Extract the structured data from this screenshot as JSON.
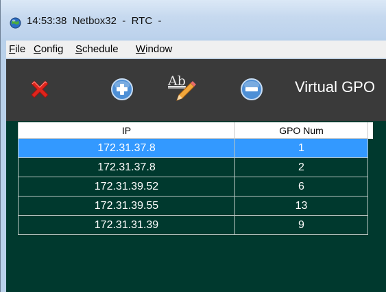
{
  "window": {
    "title": "14:53:38  Netbox32  -  RTC  -"
  },
  "menu": [
    {
      "mnemonic": "F",
      "rest": "ile"
    },
    {
      "mnemonic": "C",
      "rest": "onfig"
    },
    {
      "mnemonic": "S",
      "rest": "chedule"
    },
    {
      "mnemonic": "W",
      "rest": "indow"
    }
  ],
  "toolbar": {
    "title": "Virtual GPO",
    "icons": [
      "delete-icon",
      "add-icon",
      "rename-icon",
      "remove-icon"
    ]
  },
  "table": {
    "columns": [
      "IP",
      "GPO Num"
    ],
    "rows": [
      {
        "ip": "172.31.37.8",
        "gpo": "1",
        "selected": true
      },
      {
        "ip": "172.31.37.8",
        "gpo": "2",
        "selected": false
      },
      {
        "ip": "172.31.39.52",
        "gpo": "6",
        "selected": false
      },
      {
        "ip": "172.31.39.55",
        "gpo": "13",
        "selected": false
      },
      {
        "ip": "172.31.31.39",
        "gpo": "9",
        "selected": false
      }
    ]
  },
  "colors": {
    "toolbar_bg": "#3a3a3a",
    "content_bg": "#00392e",
    "selection": "#3399ff",
    "delete_red": "#e0241c",
    "icon_blue": "#4d8fd6"
  }
}
